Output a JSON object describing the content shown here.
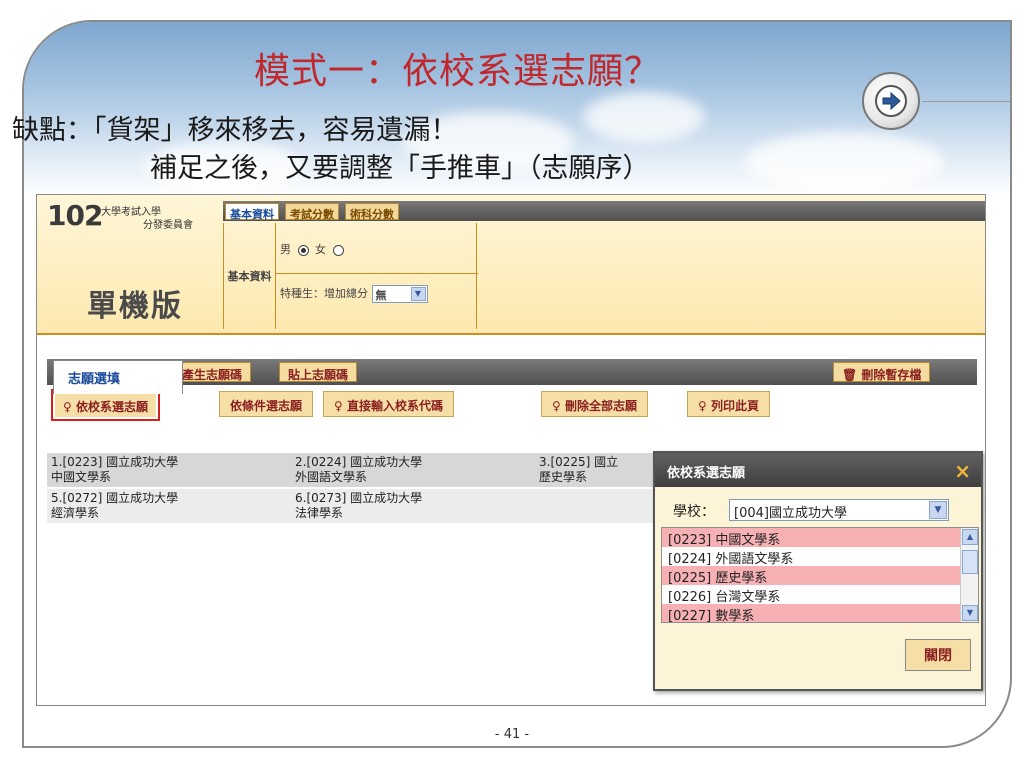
{
  "slide": {
    "title": "模式一：依校系選志願？",
    "line1": "缺點：「貨架」移來移去，容易遺漏！",
    "line2": "補足之後，又要調整「手推車」（志願序）",
    "page_number": "- 41 -"
  },
  "app": {
    "logo": {
      "number": "102",
      "line1": "大學考試入學",
      "line2": "分發委員會"
    },
    "edition": "單機版",
    "top_tabs": [
      "基本資料",
      "考試分數",
      "術科分數"
    ],
    "basic_info": {
      "section_label": "基本資料",
      "gender_male": "男",
      "gender_female": "女",
      "gender_selected": "male",
      "special_label": "特種生：增加總分",
      "special_value": "無"
    },
    "wish_tabs": {
      "active": "志願選填",
      "produce": "產生志願碼",
      "paste": "貼上志願碼",
      "delete_temp": "刪除暫存檔"
    },
    "sub_tabs": [
      "依校系選志願",
      "依條件選志願",
      "直接輸入校系代碼",
      "刪除全部志願",
      "列印此頁"
    ],
    "results": [
      [
        "1.[0223] 國立成功大學",
        "中國文學系"
      ],
      [
        "2.[0224] 國立成功大學",
        "外國語文學系"
      ],
      [
        "3.[0225] 國立",
        "歷史學系"
      ],
      [
        "5.[0272] 國立成功大學",
        "經濟學系"
      ],
      [
        "6.[0273] 國立成功大學",
        "法律學系"
      ]
    ],
    "popup": {
      "title": "依校系選志願",
      "school_label": "學校：",
      "school_value": "[004]國立成功大學",
      "departments": [
        "[0223] 中國文學系",
        "[0224] 外國語文學系",
        "[0225] 歷史學系",
        "[0226] 台灣文學系",
        "[0227] 數學系"
      ],
      "close_label": "關閉"
    }
  },
  "colors": {
    "title_red": "#c0282d",
    "header_gold": "#c98f1f",
    "tab_text": "#8a1f1f",
    "highlight": "#f7b1b4"
  }
}
